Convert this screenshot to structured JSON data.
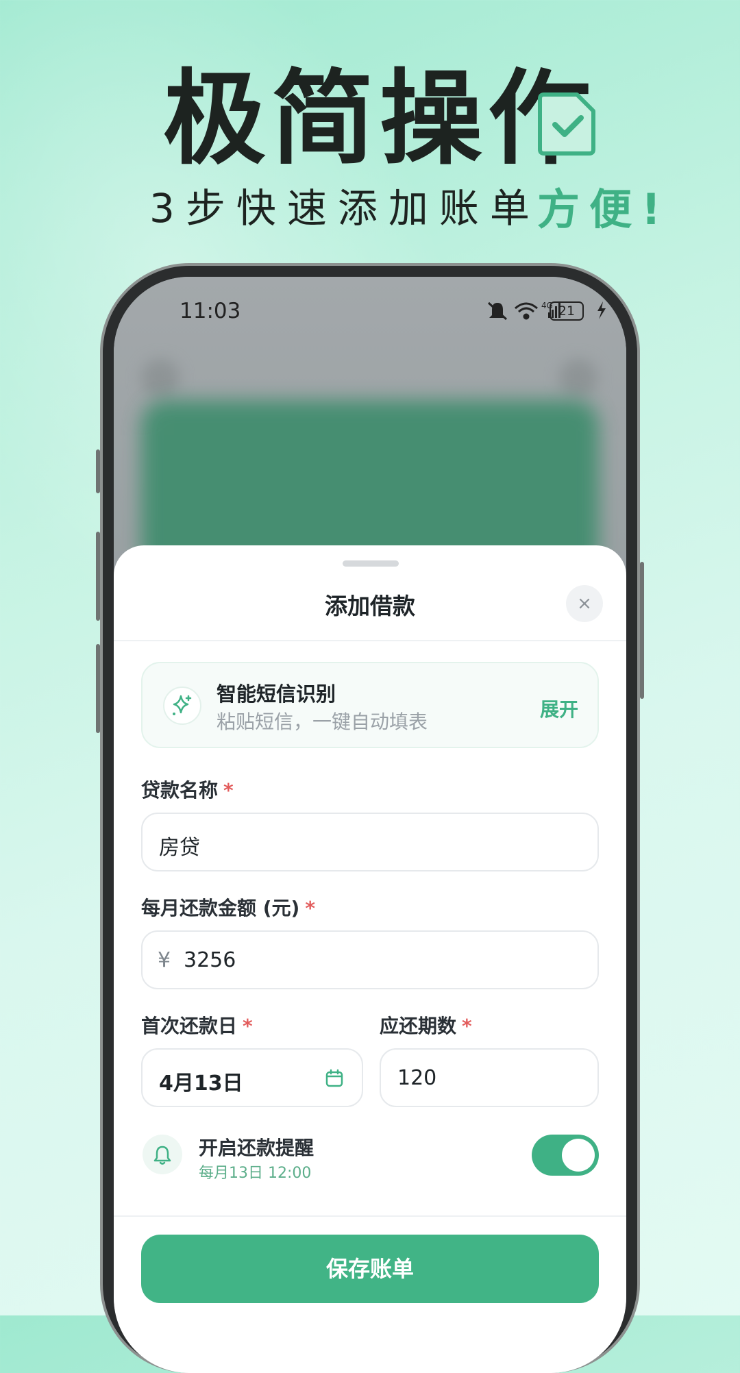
{
  "banner": {
    "headline": "极简操作",
    "subline": "3步快速添加账单",
    "subline_accent": "方便!"
  },
  "status_bar": {
    "time": "11:03",
    "battery": "21",
    "network": "4G"
  },
  "sheet": {
    "title": "添加借款",
    "close_icon": "×",
    "sms": {
      "title": "智能短信识别",
      "subtitle": "粘贴短信，一键自动填表",
      "expand_label": "展开"
    },
    "loan_name": {
      "label": "贷款名称",
      "required": "*",
      "value": "房贷"
    },
    "monthly_amount": {
      "label": "每月还款金额 (元)",
      "required": "*",
      "currency": "¥",
      "value": "3256"
    },
    "first_date": {
      "label": "首次还款日",
      "required": "*",
      "value": "4月13日"
    },
    "periods": {
      "label": "应还期数",
      "required": "*",
      "value": "120"
    },
    "reminder": {
      "title": "开启还款提醒",
      "subtitle": "每月13日 12:00",
      "enabled": true
    },
    "save_label": "保存账单"
  },
  "colors": {
    "accent": "#41b486",
    "required": "#e25b5b"
  }
}
